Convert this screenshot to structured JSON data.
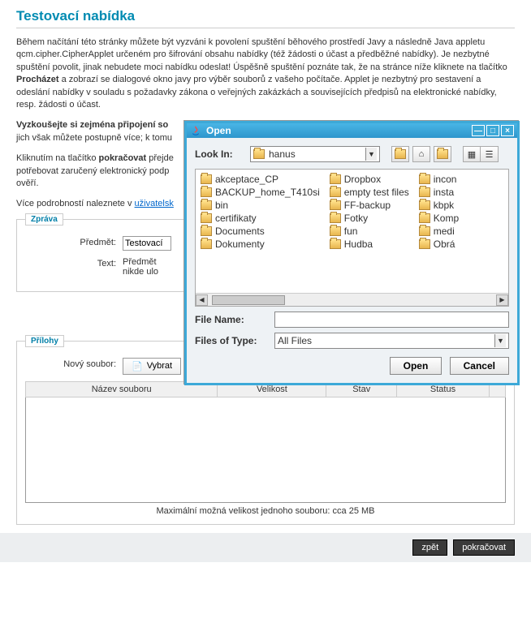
{
  "page": {
    "title": "Testovací nabídka",
    "p1a": "Během načítání této stránky můžete být vyzváni k povolení spuštění běhového prostředí Javy a následně Java appletu qcm.cipher.CipherApplet určeném pro šifrování obsahu nabídky (též žádosti o účast a předběžné nabídky). Je nezbytné spuštění povolit, jinak nebudete moci nabídku odeslat! Úspěšně spuštění poznáte tak, že na stránce níže kliknete na tlačítko ",
    "p1_bold": "Procházet",
    "p1b": " a zobrazí se dialogové okno javy pro výběr souborů z vašeho počítače. Applet je nezbytný pro sestavení a odeslání nabídky v souladu s požadavky zákona o veřejných zakázkách a souvisejících předpisů na elektronické nabídky, resp. žádosti o účast.",
    "p2_bold": "Vyzkoušejte si zejména připojení so",
    "p2_rest": " jich však můžete postupně více; k tomu",
    "p3a": "Kliknutím na tlačítko ",
    "p3_bold": "pokračovat",
    "p3b": " přejde potřebovat zaručený elektronický podp ověří.",
    "p3b_line1": " přejde",
    "p3b_line2": "potřebovat zaručený elektronický podp",
    "p3b_line3": "ověří.",
    "p4a": "Více podrobností naleznete v ",
    "p4_link": "uživatelsk"
  },
  "msg": {
    "legend": "Zpráva",
    "subject_label": "Předmět:",
    "subject_value": "Testovací",
    "text_label": "Text:",
    "text_value": "Předmět\nnikde ulo"
  },
  "attach": {
    "legend": "Přílohy",
    "new_label": "Nový soubor:",
    "select_btn": "Vybrat",
    "cols": {
      "name": "Název souboru",
      "size": "Velikost",
      "state": "Stav",
      "status": "Status"
    },
    "note": "Maximální možná velikost jednoho souboru: cca 25 MB"
  },
  "footer": {
    "back": "zpět",
    "continue": "pokračovat"
  },
  "dialog": {
    "title": "Open",
    "lookin": "Look In:",
    "folder": "hanus",
    "filename_label": "File Name:",
    "filename_value": "",
    "type_label": "Files of Type:",
    "type_value": "All Files",
    "open": "Open",
    "cancel": "Cancel",
    "files_col1": [
      "akceptace_CP",
      "BACKUP_home_T410si",
      "bin",
      "certifikaty",
      "Documents",
      "Dokumenty"
    ],
    "files_col2": [
      "Dropbox",
      "empty test files",
      "FF-backup",
      "Fotky",
      "fun",
      "Hudba"
    ],
    "files_col3": [
      "incon",
      "insta",
      "kbpk",
      "Komp",
      "medi",
      "Obrá"
    ]
  }
}
